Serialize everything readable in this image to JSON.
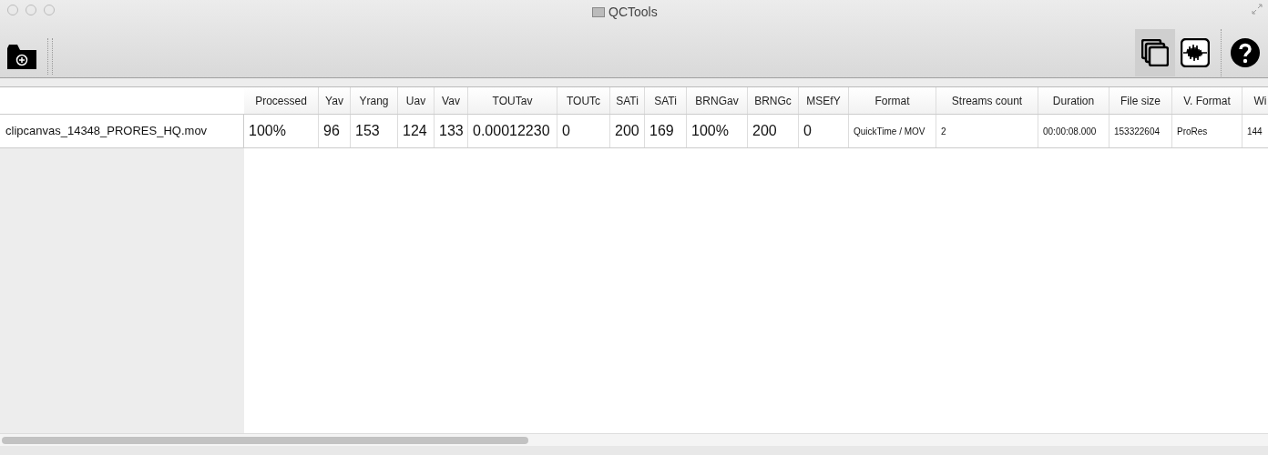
{
  "window": {
    "title": "QCTools"
  },
  "toolbar": {
    "right_buttons": [
      {
        "kind": "windows",
        "selected": true
      },
      {
        "kind": "waveform",
        "selected": false
      },
      {
        "kind": "help",
        "selected": false
      }
    ]
  },
  "table": {
    "columns": [
      "Processed",
      "Yav",
      "Yrang",
      "Uav",
      "Vav",
      "TOUTav",
      "TOUTc",
      "SATi",
      "SATi",
      "BRNGav",
      "BRNGc",
      "MSEfY",
      "Format",
      "Streams count",
      "Duration",
      "File size",
      "V. Format",
      "Wi"
    ],
    "rows": [
      {
        "file": "clipcanvas_14348_PRORES_HQ.mov",
        "cells": [
          "100%",
          "96",
          "153",
          "124",
          "133",
          "0.00012230",
          "0",
          "200",
          "169",
          "100%",
          "200",
          "0",
          "QuickTime / MOV",
          "2",
          "00:00:08.000",
          "153322604",
          "ProRes",
          "144"
        ]
      }
    ]
  }
}
